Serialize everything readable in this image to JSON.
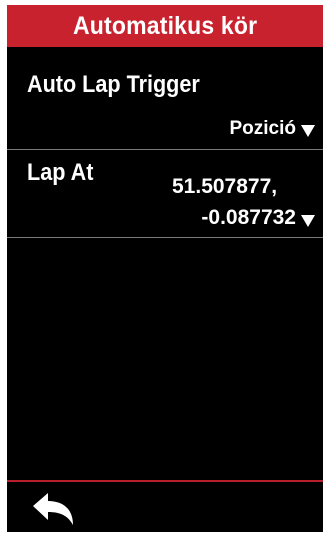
{
  "header": {
    "title": "Automatikus kör"
  },
  "settings": [
    {
      "label": "Auto Lap Trigger",
      "value": "Pozició"
    },
    {
      "label": "Lap At",
      "value_line1": "51.507877,",
      "value_line2": "-0.087732"
    }
  ],
  "footer": {
    "back_icon": "back-arrow-icon"
  },
  "colors": {
    "accent": "#c8222e",
    "background": "#000000",
    "text": "#ffffff",
    "divider": "#7a7a7a"
  }
}
